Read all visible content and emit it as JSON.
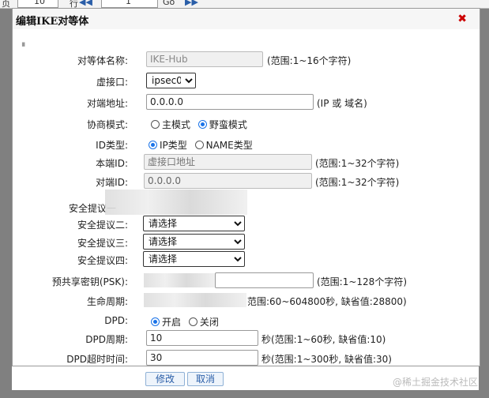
{
  "background": {
    "page_prefix": "页",
    "page_value": "10",
    "rows_label": "行",
    "nav_first": "◀◀",
    "page_input": "1",
    "go_label": "Go",
    "nav_last": "▶▶"
  },
  "dialog": {
    "title": "编辑IKE对等体",
    "close_icon": "✖",
    "fields": {
      "peer_name": {
        "label": "对等体名称:",
        "value": "IKE-Hub",
        "hint": "(范围:1~16个字符)"
      },
      "virtual_if": {
        "label": "虚接口:",
        "selected": "ipsec0"
      },
      "remote_addr": {
        "label": "对端地址:",
        "value": "0.0.0.0",
        "hint": "(IP 或 域名)"
      },
      "nego_mode": {
        "label": "协商模式:",
        "options": [
          "主模式",
          "野蛮模式"
        ],
        "selected": "野蛮模式"
      },
      "id_type": {
        "label": "ID类型:",
        "options": [
          "IP类型",
          "NAME类型"
        ],
        "selected": "IP类型"
      },
      "local_id": {
        "label": "本端ID:",
        "placeholder": "虚接口地址",
        "hint": "(范围:1~32个字符)"
      },
      "remote_id": {
        "label": "对端ID:",
        "value": "0.0.0.0",
        "hint": "(范围:1~32个字符)"
      },
      "proposal1": {
        "label": "安全提议一"
      },
      "proposal2": {
        "label": "安全提议二:",
        "selected": "请选择"
      },
      "proposal3": {
        "label": "安全提议三:",
        "selected": "请选择"
      },
      "proposal4": {
        "label": "安全提议四:",
        "selected": "请选择"
      },
      "psk": {
        "label": "预共享密钥(PSK):",
        "hint": "(范围:1~128个字符)"
      },
      "lifetime": {
        "label": "生命周期:",
        "hint": "范围:60~604800秒, 缺省值:28800)"
      },
      "dpd": {
        "label": "DPD:",
        "options": [
          "开启",
          "关闭"
        ],
        "selected": "开启"
      },
      "dpd_period": {
        "label": "DPD周期:",
        "value": "10",
        "hint": "秒(范围:1~60秒, 缺省值:10)"
      },
      "dpd_timeout": {
        "label": "DPD超时时间:",
        "value": "30",
        "hint": "秒(范围:1~300秒, 缺省值:30)"
      }
    },
    "buttons": {
      "modify": "修改",
      "cancel": "取消"
    }
  },
  "watermark": "@稀土掘金技术社区",
  "colors": {
    "accent": "#1a73e8",
    "close": "#cc0000",
    "button_text": "#2a5ea8"
  }
}
